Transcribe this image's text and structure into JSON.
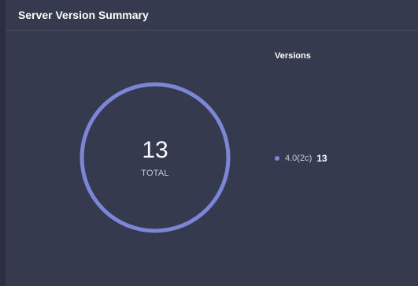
{
  "card": {
    "title": "Server Version Summary"
  },
  "summary": {
    "total_value": "13",
    "total_label": "TOTAL"
  },
  "legend": {
    "title": "Versions",
    "items": [
      {
        "label": "4.0(2c)",
        "count": "13",
        "color": "#7b86d6"
      }
    ]
  },
  "chart_data": {
    "type": "pie",
    "categories": [
      "4.0(2c)"
    ],
    "values": [
      13
    ],
    "title": "Server Version Summary",
    "total": 13
  }
}
